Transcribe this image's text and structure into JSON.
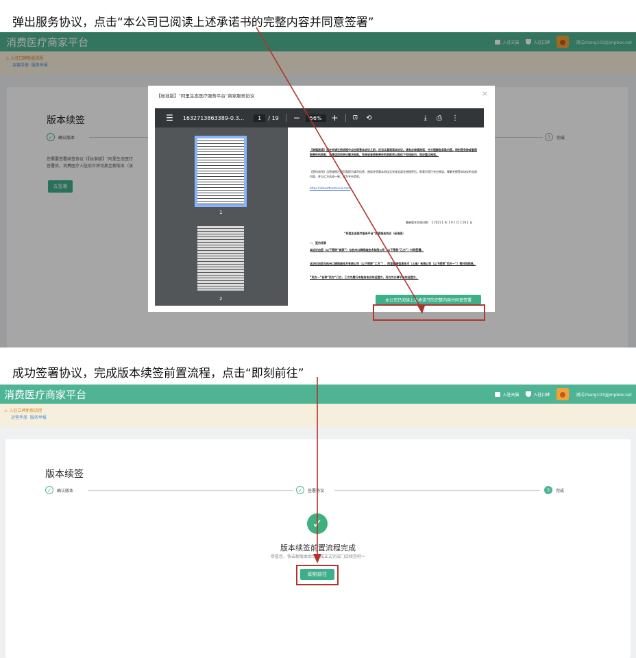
{
  "captions": {
    "top": "弹出服务协议，点击“本公司已阅读上述承诺书的完整内容并同意签署”",
    "bottom": "成功签署协议，完成版本续签前置流程，点击“即刻前往”"
  },
  "app": {
    "brand": "消费医疗商家平台",
    "nav": {
      "shop": "入驻天猫",
      "reg": "入驻口碑",
      "user": "测试zhang103@jmpbox.net"
    },
    "notice": {
      "line1": "入驻口碑新版流程",
      "link1": "运营手册",
      "link2": "服务举报"
    }
  },
  "colors": {
    "brand": "#4fb493",
    "notice_bg": "#f7efde",
    "highlight": "#b0342c"
  },
  "screen1": {
    "title": "版本续签",
    "step1": "确认版本",
    "step3_num": "3",
    "step3": "完成",
    "desc1": "您需要签署续签协议《【标准版】“阿里生态医疗",
    "desc2": "签署后，消费医疗入驻后台将切换至新版本（该",
    "sign_btn": "去签署",
    "modal": {
      "title": "【标准版】“阿里生态医疗服务平台”商家服务协议",
      "close": "×",
      "filename": "1632713863389-0.3...",
      "page": "1",
      "pages": "/ 19",
      "zoom": "56%",
      "thumb1_num": "1",
      "thumb2_num": "2",
      "agree_btn": "本公司已阅读上述承诺书的完整内容并同意签署",
      "doc": {
        "p1": "【审慎阅读】您在申请注册流程中点击同意本协议之前，应当认真阅读本协议。请务必审慎阅读、充分理解各条款内容，特别是免除或者限制责任的条款、法律适用和争议解决条款。免除或者限制责任的条款将以粗体下划线标识，您应重点阅读。",
        "p2": "【签约动作】当您按照注册页面提示填写信息、阅读并同意本协议且完成全部注册程序后，即表示您已充分阅读、理解并接受本协议的全部内容，并与乙方达成一致，成为平台商家。",
        "link": "https://alihealthexternal.com/",
        "date": "最新版本生效日期：【 2021 】年【 9 】月【 26 】日",
        "heading": "“阿里生态医疗服务平台”商家服务协议（标准版）",
        "sec": "一、签约背景",
        "i1": "本协议由您（以下简称“商家”）与杭州口碑网络技术有限公司（以下简称“乙方”）共同签署。",
        "i2": "本协议由您与杭州口碑网络技术有限公司（以下简称“乙方”）、阿里健康信息技术（上海）有限公司（以下简称“丙方一”）等共同缔结。",
        "i3": "“丙方一”合称“丙方”订立，乙方为履行本服务协议的运营方，丙方为口碑平台的运营方。"
      }
    }
  },
  "screen2": {
    "title": "版本续签",
    "step1": "确认版本",
    "step2": "签署协议",
    "step3_num": "3",
    "step3": "完成",
    "done_title": "版本续签前置流程完成",
    "done_sub": "恭喜您，快去新版本后台完成正式完成门店续签吧～",
    "go_btn": "即刻前往"
  }
}
